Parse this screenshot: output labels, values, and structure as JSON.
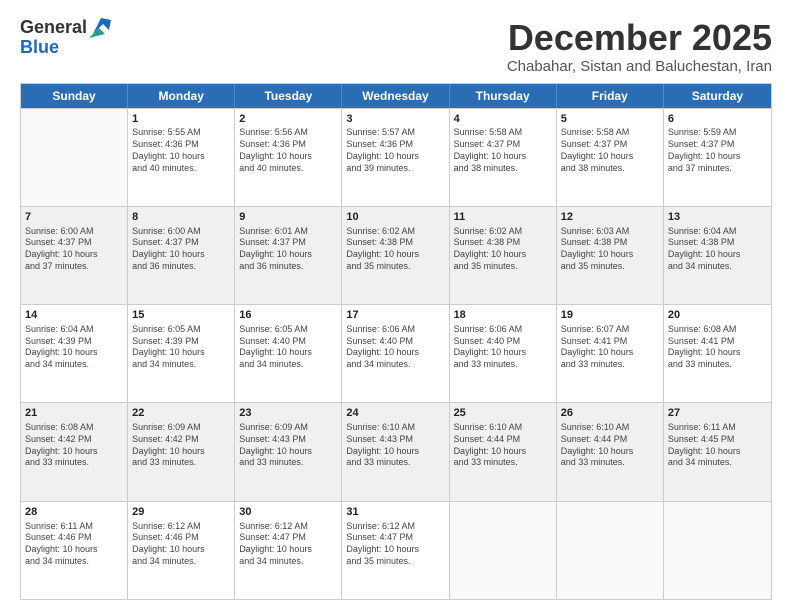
{
  "logo": {
    "general": "General",
    "blue": "Blue"
  },
  "title": "December 2025",
  "subtitle": "Chabahar, Sistan and Baluchestan, Iran",
  "headers": [
    "Sunday",
    "Monday",
    "Tuesday",
    "Wednesday",
    "Thursday",
    "Friday",
    "Saturday"
  ],
  "weeks": [
    [
      {
        "day": "",
        "info": "",
        "empty": true
      },
      {
        "day": "1",
        "info": "Sunrise: 5:55 AM\nSunset: 4:36 PM\nDaylight: 10 hours\nand 40 minutes."
      },
      {
        "day": "2",
        "info": "Sunrise: 5:56 AM\nSunset: 4:36 PM\nDaylight: 10 hours\nand 40 minutes."
      },
      {
        "day": "3",
        "info": "Sunrise: 5:57 AM\nSunset: 4:36 PM\nDaylight: 10 hours\nand 39 minutes."
      },
      {
        "day": "4",
        "info": "Sunrise: 5:58 AM\nSunset: 4:37 PM\nDaylight: 10 hours\nand 38 minutes."
      },
      {
        "day": "5",
        "info": "Sunrise: 5:58 AM\nSunset: 4:37 PM\nDaylight: 10 hours\nand 38 minutes."
      },
      {
        "day": "6",
        "info": "Sunrise: 5:59 AM\nSunset: 4:37 PM\nDaylight: 10 hours\nand 37 minutes."
      }
    ],
    [
      {
        "day": "7",
        "info": "Sunrise: 6:00 AM\nSunset: 4:37 PM\nDaylight: 10 hours\nand 37 minutes."
      },
      {
        "day": "8",
        "info": "Sunrise: 6:00 AM\nSunset: 4:37 PM\nDaylight: 10 hours\nand 36 minutes."
      },
      {
        "day": "9",
        "info": "Sunrise: 6:01 AM\nSunset: 4:37 PM\nDaylight: 10 hours\nand 36 minutes."
      },
      {
        "day": "10",
        "info": "Sunrise: 6:02 AM\nSunset: 4:38 PM\nDaylight: 10 hours\nand 35 minutes."
      },
      {
        "day": "11",
        "info": "Sunrise: 6:02 AM\nSunset: 4:38 PM\nDaylight: 10 hours\nand 35 minutes."
      },
      {
        "day": "12",
        "info": "Sunrise: 6:03 AM\nSunset: 4:38 PM\nDaylight: 10 hours\nand 35 minutes."
      },
      {
        "day": "13",
        "info": "Sunrise: 6:04 AM\nSunset: 4:38 PM\nDaylight: 10 hours\nand 34 minutes."
      }
    ],
    [
      {
        "day": "14",
        "info": "Sunrise: 6:04 AM\nSunset: 4:39 PM\nDaylight: 10 hours\nand 34 minutes."
      },
      {
        "day": "15",
        "info": "Sunrise: 6:05 AM\nSunset: 4:39 PM\nDaylight: 10 hours\nand 34 minutes."
      },
      {
        "day": "16",
        "info": "Sunrise: 6:05 AM\nSunset: 4:40 PM\nDaylight: 10 hours\nand 34 minutes."
      },
      {
        "day": "17",
        "info": "Sunrise: 6:06 AM\nSunset: 4:40 PM\nDaylight: 10 hours\nand 34 minutes."
      },
      {
        "day": "18",
        "info": "Sunrise: 6:06 AM\nSunset: 4:40 PM\nDaylight: 10 hours\nand 33 minutes."
      },
      {
        "day": "19",
        "info": "Sunrise: 6:07 AM\nSunset: 4:41 PM\nDaylight: 10 hours\nand 33 minutes."
      },
      {
        "day": "20",
        "info": "Sunrise: 6:08 AM\nSunset: 4:41 PM\nDaylight: 10 hours\nand 33 minutes."
      }
    ],
    [
      {
        "day": "21",
        "info": "Sunrise: 6:08 AM\nSunset: 4:42 PM\nDaylight: 10 hours\nand 33 minutes."
      },
      {
        "day": "22",
        "info": "Sunrise: 6:09 AM\nSunset: 4:42 PM\nDaylight: 10 hours\nand 33 minutes."
      },
      {
        "day": "23",
        "info": "Sunrise: 6:09 AM\nSunset: 4:43 PM\nDaylight: 10 hours\nand 33 minutes."
      },
      {
        "day": "24",
        "info": "Sunrise: 6:10 AM\nSunset: 4:43 PM\nDaylight: 10 hours\nand 33 minutes."
      },
      {
        "day": "25",
        "info": "Sunrise: 6:10 AM\nSunset: 4:44 PM\nDaylight: 10 hours\nand 33 minutes."
      },
      {
        "day": "26",
        "info": "Sunrise: 6:10 AM\nSunset: 4:44 PM\nDaylight: 10 hours\nand 33 minutes."
      },
      {
        "day": "27",
        "info": "Sunrise: 6:11 AM\nSunset: 4:45 PM\nDaylight: 10 hours\nand 34 minutes."
      }
    ],
    [
      {
        "day": "28",
        "info": "Sunrise: 6:11 AM\nSunset: 4:46 PM\nDaylight: 10 hours\nand 34 minutes."
      },
      {
        "day": "29",
        "info": "Sunrise: 6:12 AM\nSunset: 4:46 PM\nDaylight: 10 hours\nand 34 minutes."
      },
      {
        "day": "30",
        "info": "Sunrise: 6:12 AM\nSunset: 4:47 PM\nDaylight: 10 hours\nand 34 minutes."
      },
      {
        "day": "31",
        "info": "Sunrise: 6:12 AM\nSunset: 4:47 PM\nDaylight: 10 hours\nand 35 minutes."
      },
      {
        "day": "",
        "info": "",
        "empty": true
      },
      {
        "day": "",
        "info": "",
        "empty": true
      },
      {
        "day": "",
        "info": "",
        "empty": true
      }
    ]
  ]
}
